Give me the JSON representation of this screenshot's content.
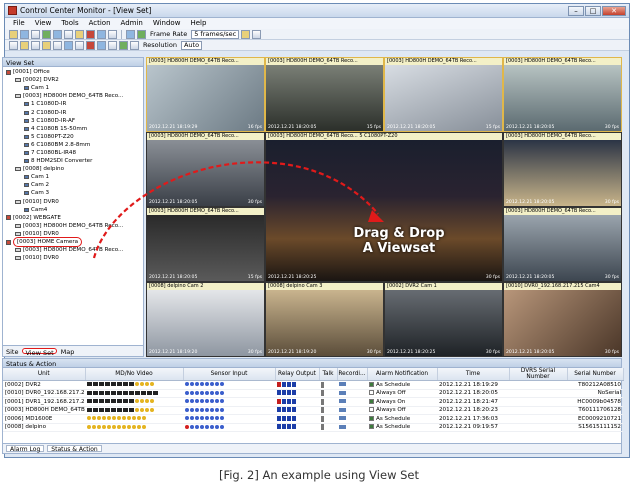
{
  "window": {
    "title": "Control Center Monitor - [View Set]"
  },
  "menu": [
    "File",
    "View",
    "Tools",
    "Action",
    "Admin",
    "Window",
    "Help"
  ],
  "toolbar": {
    "frame_rate_label": "Frame Rate",
    "frame_rate_value": "5 frames/sec",
    "resolution_label": "Resolution",
    "resolution_value": "Auto"
  },
  "left_panel": {
    "title": "View Set",
    "tree": [
      {
        "label": "[0001] Office",
        "level": 0,
        "type": "room"
      },
      {
        "label": "[0002] DVR2",
        "level": 1,
        "type": "dvr"
      },
      {
        "label": "Cam 1",
        "level": 2,
        "type": "cam"
      },
      {
        "label": "[0003] HD800H DEMO_64TB Reco...",
        "level": 1,
        "type": "dvr"
      },
      {
        "label": "1 C1080D-IR",
        "level": 2,
        "type": "cam"
      },
      {
        "label": "2 C1080D-IR",
        "level": 2,
        "type": "cam"
      },
      {
        "label": "3 C1080D-IR-AF",
        "level": 2,
        "type": "cam"
      },
      {
        "label": "4 C1080B 15-50mm",
        "level": 2,
        "type": "cam"
      },
      {
        "label": "5 C1080PT-Z20",
        "level": 2,
        "type": "cam"
      },
      {
        "label": "6 C1080BM 2.8-8mm",
        "level": 2,
        "type": "cam"
      },
      {
        "label": "7 C1080BL-IR48",
        "level": 2,
        "type": "cam"
      },
      {
        "label": "8 HDM2SDI Converter",
        "level": 2,
        "type": "cam"
      },
      {
        "label": "[0008] delpino",
        "level": 1,
        "type": "dvr"
      },
      {
        "label": "Cam 1",
        "level": 2,
        "type": "cam"
      },
      {
        "label": "Cam 2",
        "level": 2,
        "type": "cam"
      },
      {
        "label": "Cam 3",
        "level": 2,
        "type": "cam"
      },
      {
        "label": "[0010] DVR0",
        "level": 1,
        "type": "dvr"
      },
      {
        "label": "Cam4",
        "level": 2,
        "type": "cam"
      },
      {
        "label": "[0002] WEBGATE",
        "level": 0,
        "type": "room"
      },
      {
        "label": "[0003] HD800H DEMO_64TB Reco...",
        "level": 1,
        "type": "dvr"
      },
      {
        "label": "[0010] DVR0",
        "level": 1,
        "type": "dvr"
      },
      {
        "label": "[0003] HOME Camera",
        "level": 0,
        "type": "room",
        "highlight": true
      },
      {
        "label": "[0003] HD800H DEMO_64TB Reco...",
        "level": 1,
        "type": "dvr"
      },
      {
        "label": "[0010] DVR0",
        "level": 1,
        "type": "dvr"
      }
    ],
    "tabs": [
      "Site",
      "View Set",
      "Map"
    ],
    "active_tab": "View Set"
  },
  "video_tiles": [
    {
      "caption": "[0003] HD800H DEMO_64TB Reco...",
      "timestamp": "2012.12.21 18:19:29",
      "fps": "16 fps"
    },
    {
      "caption": "[0003] HD800H DEMO_64TB Reco...",
      "timestamp": "2012.12.21 18:20:05",
      "fps": "15 fps"
    },
    {
      "caption": "[0003] HD800H DEMO_64TB Reco...",
      "timestamp": "2012.12.21 18:20:05",
      "fps": "15 fps"
    },
    {
      "caption": "[0003] HD800H DEMO_64TB Reco...",
      "timestamp": "2012.12.21 18:20:05",
      "fps": "30 fps"
    },
    {
      "caption": "[0003] HD800H DEMO_64TB Reco... 5 C1080PT-Z20",
      "timestamp": "2012.12.21 18:20:25",
      "fps": "30 fps"
    },
    {
      "caption": "[0003] HD800H DEMO_64TB Reco...",
      "timestamp": "2012.12.21 18:20:05",
      "fps": "30 fps"
    },
    {
      "caption": "[0003] HD800H DEMO_64TB Reco...",
      "timestamp": "2012.12.21 18:20:05",
      "fps": "30 fps"
    },
    {
      "caption": "[0003] HD800H DEMO_64TB Reco...",
      "timestamp": "2012.12.21 18:20:05",
      "fps": "15 fps"
    },
    {
      "caption": "[0003] HD800H DEMO_64TB Reco...",
      "timestamp": "2012.12.21 18:20:05",
      "fps": "30 fps"
    },
    {
      "caption": "[0008] delpino Cam 2",
      "timestamp": "2012.12.21 18:19:20",
      "fps": "30 fps"
    },
    {
      "caption": "[0008] delpino Cam 3",
      "timestamp": "2012.12.21 18:19:20",
      "fps": "30 fps"
    },
    {
      "caption": "[0002] DVR2 Cam 1",
      "timestamp": "2012.12.21 18:20:25",
      "fps": "30 fps"
    },
    {
      "caption": "[0010] DVR0_192.168.217.215 Cam4",
      "timestamp": "2012.12.21 18:20:05",
      "fps": "30 fps"
    }
  ],
  "center_tile_small": {
    "caption": "[0008] delpino Cam 1",
    "timestamp": "2012.12.21 18:19:20",
    "fps": "30 fps"
  },
  "overlay": {
    "line1": "Drag & Drop",
    "line2": "A Viewset"
  },
  "status_panel": {
    "title": "Status & Action",
    "columns": [
      "Unit",
      "MD/No Video",
      "Sensor Input",
      "Relay Output",
      "Talk",
      "Recordi...",
      "Alarm Notification",
      "Time",
      "DVRS Serial Number",
      "Serial Number"
    ],
    "rows": [
      {
        "unit": "[0002] DVR2",
        "alarm": "As Schedule",
        "checked": true,
        "time": "2012.12.21 18:19:29",
        "dvrs": "",
        "serial": "T80212A08510"
      },
      {
        "unit": "[0010] DVR0_192.168.217.2...",
        "alarm": "Always Off",
        "checked": false,
        "time": "2012.12.21 18:20:05",
        "dvrs": "",
        "serial": "NoSerial"
      },
      {
        "unit": "[0001] DVR1_192.168.217.2...",
        "alarm": "Always On",
        "checked": true,
        "time": "2012.12.21 18:21:47",
        "dvrs": "",
        "serial": "HC0009b04578"
      },
      {
        "unit": "[0003] HD800H DEMO_64TB ...",
        "alarm": "Always Off",
        "checked": false,
        "time": "2012.12.21 18:20:23",
        "dvrs": "",
        "serial": "T60111706128"
      },
      {
        "unit": "[0006] MD1600E",
        "alarm": "As Schedule",
        "checked": true,
        "time": "2012.12.21 17:36:03",
        "dvrs": "",
        "serial": "EC0009210721"
      },
      {
        "unit": "[0008] delpino",
        "alarm": "As Schedule",
        "checked": true,
        "time": "2012.12.21 09:19:57",
        "dvrs": "",
        "serial": "S15615111152"
      }
    ],
    "tabs": [
      "Alarm Log",
      "Status & Action"
    ]
  },
  "figure_caption": "[Fig. 2] An example using View Set"
}
